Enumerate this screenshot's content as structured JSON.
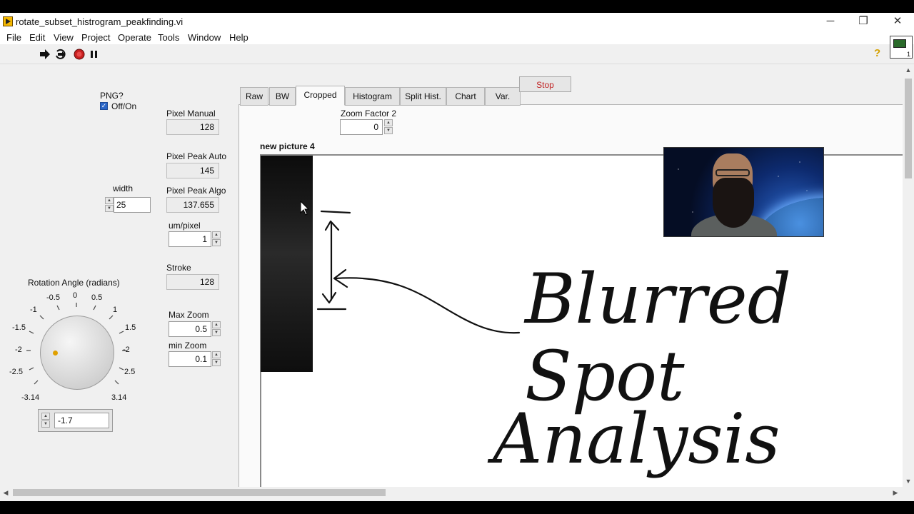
{
  "window": {
    "title": "rotate_subset_histrogram_peakfinding.vi"
  },
  "window_controls": {
    "minimize": "─",
    "restore": "❐",
    "close": "✕"
  },
  "menu": [
    "File",
    "Edit",
    "View",
    "Project",
    "Operate",
    "Tools",
    "Window",
    "Help"
  ],
  "toolbar": {
    "icons": [
      "run-icon",
      "run-continuously-icon",
      "abort-icon",
      "pause-icon"
    ],
    "help": "?",
    "vi_icon_number": "1"
  },
  "controls": {
    "png": {
      "label": "PNG?",
      "checkbox_label": "Off/On",
      "checked": true,
      "check_mark": "✓"
    },
    "width": {
      "label": "width",
      "value": "25"
    },
    "rotation": {
      "label": "Rotation Angle (radians)",
      "value": "-1.7",
      "ticks": [
        "0",
        "-0.5",
        "0.5",
        "-1",
        "1",
        "-1.5",
        "1.5",
        "-2",
        "-2",
        "-2.5",
        "2.5",
        "-3.14",
        "3.14"
      ]
    },
    "pixel_manual": {
      "label": "Pixel Manual",
      "value": "128"
    },
    "pixel_peak_auto": {
      "label": "Pixel Peak Auto",
      "value": "145"
    },
    "pixel_peak_algo": {
      "label": "Pixel Peak Algo",
      "value": "137.655"
    },
    "um_pixel": {
      "label": "um/pixel",
      "value": "1"
    },
    "stroke": {
      "label": "Stroke",
      "value": "128"
    },
    "max_zoom": {
      "label": "Max Zoom",
      "value": "0.5"
    },
    "min_zoom": {
      "label": "min Zoom",
      "value": "0.1"
    }
  },
  "tabs": [
    {
      "label": "Raw",
      "active": false
    },
    {
      "label": "BW",
      "active": false
    },
    {
      "label": "Cropped",
      "active": true
    },
    {
      "label": "Histogram",
      "active": false
    },
    {
      "label": "Split Hist.",
      "active": false
    },
    {
      "label": "Chart",
      "active": false
    },
    {
      "label": "Var.",
      "active": false
    }
  ],
  "stop_button": "Stop",
  "cropped_tab": {
    "zoom_label": "Zoom Factor 2",
    "zoom_value": "0",
    "picture_label": "new picture 4"
  },
  "annotation": {
    "line1": "Blurred",
    "line2": "Spot",
    "line3": "Analysis"
  },
  "colors": {
    "accent_knob_dot": "#e0a000",
    "stop_text": "#c02020",
    "checkbox": "#2a66c8"
  }
}
